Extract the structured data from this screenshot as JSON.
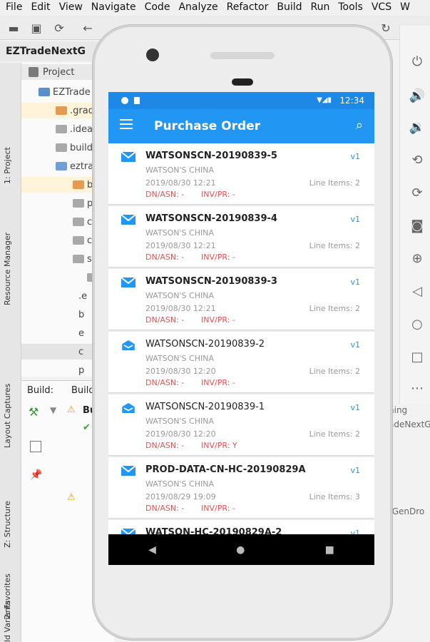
{
  "menu": [
    "File",
    "Edit",
    "View",
    "Navigate",
    "Code",
    "Analyze",
    "Refactor",
    "Build",
    "Run",
    "Tools",
    "VCS",
    "W"
  ],
  "project_title": "EZTradeNextG",
  "project_panel": {
    "header": "Project",
    "rows": [
      "EZTrade",
      ".grad",
      ".idea",
      "build",
      "eztra",
      "b",
      "p",
      "c",
      "c",
      "s",
      "",
      ".e",
      "b",
      "e",
      "c",
      "p"
    ]
  },
  "build_panel": {
    "tab1": "Build:",
    "tab2": "Build",
    "item": "Bu"
  },
  "left_tabs": [
    "1: Project",
    "Resource Manager",
    "Layout Captures",
    "Z: Structure",
    "2: Favorites",
    "ld Variants"
  ],
  "right_texts": [
    "ning",
    "adeNextG",
    "tGenDro"
  ],
  "phone": {
    "status": {
      "time": "12:34"
    },
    "appbar": {
      "title": "Purchase Order"
    },
    "orders": [
      {
        "po": "WATSONSCN-20190839-5",
        "company": "WATSON'S CHINA",
        "date": "2019/08/30 12:21",
        "line_items": "Line Items: 2",
        "version": "v1",
        "dn": "DN/ASN: -",
        "inv": "INV/PR: -",
        "icon": "mail-icon",
        "bold": true
      },
      {
        "po": "WATSONSCN-20190839-4",
        "company": "WATSON'S CHINA",
        "date": "2019/08/30 12:21",
        "line_items": "Line Items: 2",
        "version": "v1",
        "dn": "DN/ASN: -",
        "inv": "INV/PR: -",
        "icon": "mail-icon",
        "bold": true
      },
      {
        "po": "WATSONSCN-20190839-3",
        "company": "WATSON'S CHINA",
        "date": "2019/08/30 12:21",
        "line_items": "Line Items: 2",
        "version": "v1",
        "dn": "DN/ASN: -",
        "inv": "INV/PR: -",
        "icon": "mail-icon",
        "bold": true
      },
      {
        "po": "WATSONSCN-20190839-2",
        "company": "WATSON'S CHINA",
        "date": "2019/08/30 12:20",
        "line_items": "Line Items: 2",
        "version": "v1",
        "dn": "DN/ASN: -",
        "inv": "INV/PR: -",
        "icon": "mail-open-icon",
        "bold": false
      },
      {
        "po": "WATSONSCN-20190839-1",
        "company": "WATSON'S CHINA",
        "date": "2019/08/30 12:20",
        "line_items": "Line Items: 2",
        "version": "v1",
        "dn": "DN/ASN: -",
        "inv": "INV/PR: Y",
        "icon": "mail-open-icon",
        "bold": false
      },
      {
        "po": "PROD-DATA-CN-HC-20190829A",
        "company": "WATSON'S CHINA",
        "date": "2019/08/29 19:09",
        "line_items": "Line Items: 3",
        "version": "v1",
        "dn": "DN/ASN: -",
        "inv": "INV/PR: -",
        "icon": "mail-icon",
        "bold": true
      },
      {
        "po": "WATSON-HC-20190829A-2",
        "company": "",
        "date": "",
        "line_items": "",
        "version": "v1",
        "dn": "",
        "inv": "",
        "icon": "mail-icon",
        "bold": true
      }
    ]
  },
  "colors": {
    "accent": "#2196f3",
    "status_bar": "#1e88e5",
    "red_text": "#e05353"
  }
}
